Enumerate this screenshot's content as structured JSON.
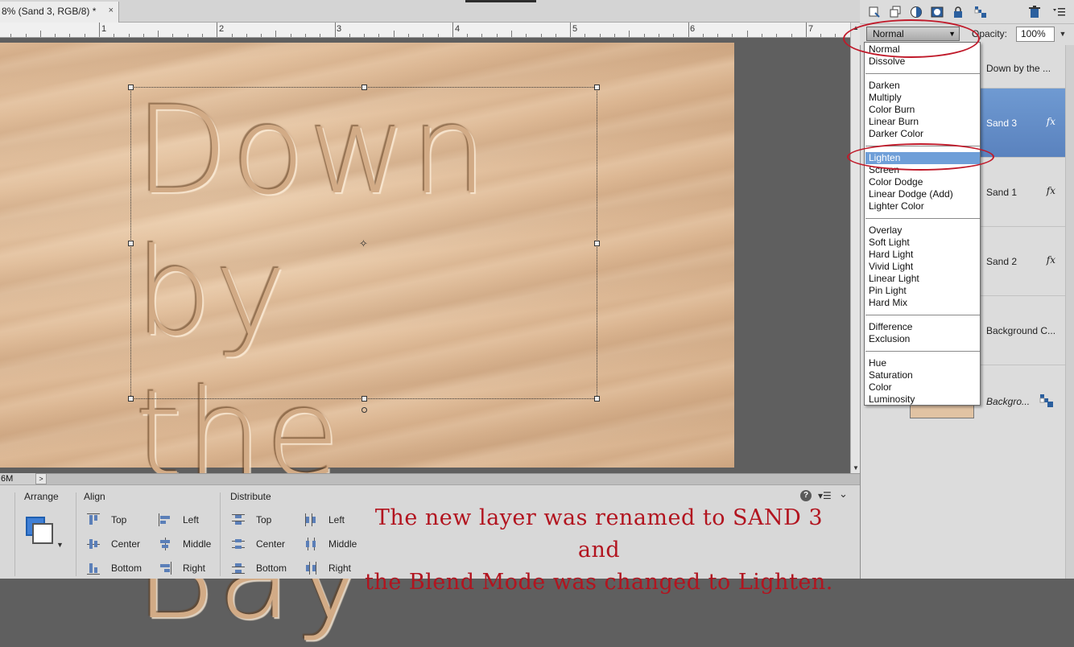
{
  "document_tab": {
    "title": "8% (Sand 3, RGB/8) *",
    "close": "×"
  },
  "ruler": {
    "labels": [
      "1",
      "2",
      "3",
      "4",
      "5",
      "6",
      "7"
    ]
  },
  "canvas": {
    "text_line1": "Down by",
    "text_line2": "the Bay"
  },
  "status": {
    "zoom": "6M"
  },
  "options": {
    "arrange_title": "Arrange",
    "align_title": "Align",
    "distribute_title": "Distribute",
    "align": {
      "top": "Top",
      "center": "Center",
      "bottom": "Bottom",
      "left": "Left",
      "middle": "Middle",
      "right": "Right"
    },
    "distribute": {
      "top": "Top",
      "center": "Center",
      "bottom": "Bottom",
      "left": "Left",
      "middle": "Middle",
      "right": "Right"
    },
    "help": "?",
    "menu": "▾☰",
    "collapse": "⌄"
  },
  "caption": {
    "line1": "The new layer was renamed to SAND 3 and",
    "line2": "the Blend Mode was changed to Lighten."
  },
  "colors": {
    "annotation": "#c01a2a",
    "selection": "#6f9fd8",
    "caption": "#b2141f",
    "sand": "#ddb894"
  },
  "layers_panel": {
    "blend_mode": "Normal",
    "opacity_label": "Opacity:",
    "opacity_value": "100%",
    "toolbar_icons": [
      "new-layer-icon",
      "group-layers-icon",
      "adjustment-layer-icon",
      "layer-mask-icon",
      "lock-icon",
      "lock-transparency-icon",
      "trash-icon",
      "panel-menu-icon"
    ],
    "layers": [
      {
        "name": "Down by the ...",
        "fx": ""
      },
      {
        "name": "Sand 3",
        "fx": "fx"
      },
      {
        "name": "Sand 1",
        "fx": "fx"
      },
      {
        "name": "Sand 2",
        "fx": "fx"
      },
      {
        "name": "Background C...",
        "fx": ""
      },
      {
        "name": "Backgro...",
        "fx": ""
      }
    ],
    "blend_modes": {
      "normal": "Normal",
      "dissolve": "Dissolve",
      "darken": "Darken",
      "multiply": "Multiply",
      "color_burn": "Color Burn",
      "linear_burn": "Linear Burn",
      "darker_color": "Darker Color",
      "lighten": "Lighten",
      "screen": "Screen",
      "color_dodge": "Color Dodge",
      "linear_dodge": "Linear Dodge (Add)",
      "lighter_color": "Lighter Color",
      "overlay": "Overlay",
      "soft_light": "Soft Light",
      "hard_light": "Hard Light",
      "vivid_light": "Vivid Light",
      "linear_light": "Linear Light",
      "pin_light": "Pin Light",
      "hard_mix": "Hard Mix",
      "difference": "Difference",
      "exclusion": "Exclusion",
      "hue": "Hue",
      "saturation": "Saturation",
      "color": "Color",
      "luminosity": "Luminosity"
    }
  }
}
